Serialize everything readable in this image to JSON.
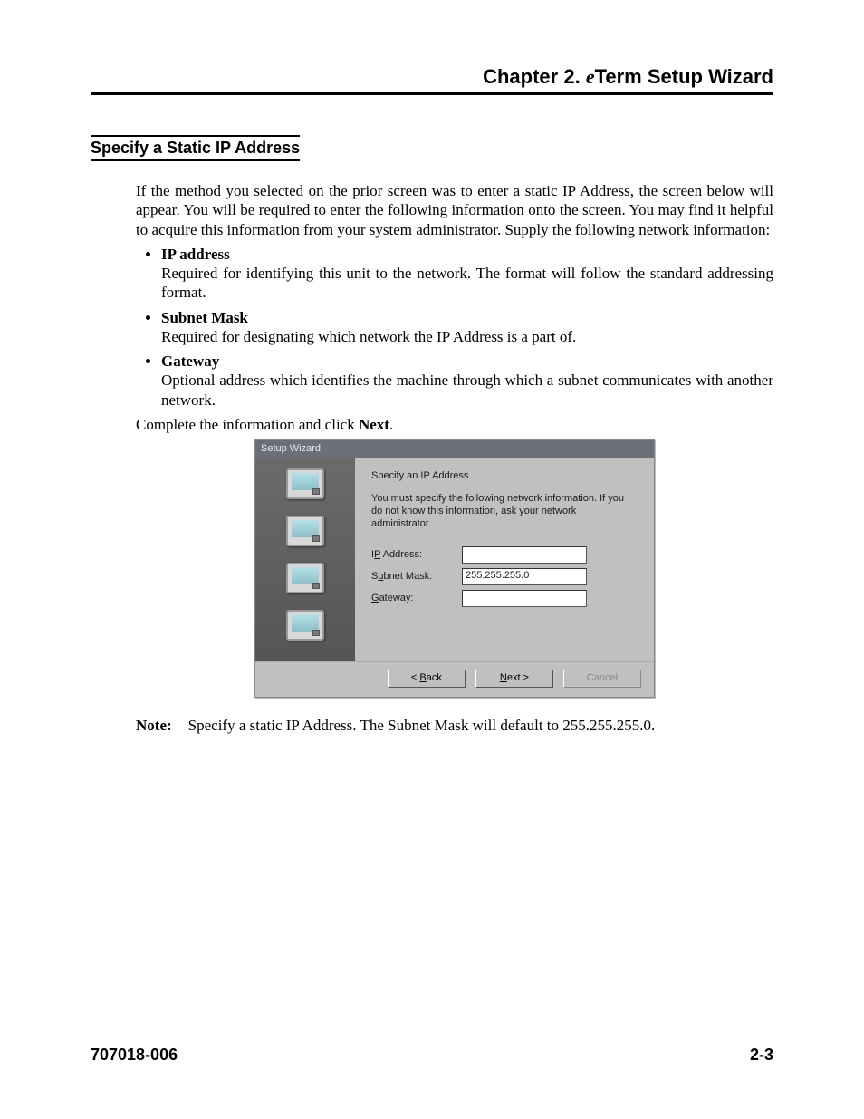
{
  "header": {
    "chapter_label": "Chapter 2.",
    "chapter_e": "e",
    "chapter_title": "Term Setup Wizard"
  },
  "section": {
    "title": "Specify a Static IP Address"
  },
  "intro": "If the method you selected on the prior screen was to enter a static IP Address, the screen below will appear. You will be required to enter the following information onto the screen. You may find it helpful to acquire this information from your system administrator. Supply the following network information:",
  "items": [
    {
      "term": "IP address",
      "desc": "Required for identifying this unit to the network. The format will follow the standard addressing format."
    },
    {
      "term": "Subnet Mask",
      "desc": "Required for designating which network the IP Address is a part of."
    },
    {
      "term": "Gateway",
      "desc": "Optional address which identifies the machine through which a subnet communicates with another network."
    }
  ],
  "action": {
    "pre": "Complete the information and click ",
    "button": "Next",
    "post": "."
  },
  "dialog": {
    "title": "Setup Wizard",
    "heading": "Specify an IP Address",
    "sub": "You must specify the following network information. If you do not know this information, ask your network administrator.",
    "labels": {
      "ip_u": "P",
      "ip_rest": " Address:",
      "ip_pre": "I",
      "sub_pre": "S",
      "sub_u": "u",
      "sub_rest": "bnet Mask:",
      "gw_u": "G",
      "gw_rest": "ateway:"
    },
    "values": {
      "ip": "",
      "subnet": "255.255.255.0",
      "gateway": ""
    },
    "buttons": {
      "back_pre": "< ",
      "back_u": "B",
      "back_rest": "ack",
      "next_u": "N",
      "next_rest": "ext >",
      "cancel": "Cancel"
    }
  },
  "note": {
    "label": "Note:",
    "text": "Specify a static IP Address. The Subnet Mask will default to 255.255.255.0."
  },
  "footer": {
    "doc": "707018-006",
    "page": "2-3"
  }
}
